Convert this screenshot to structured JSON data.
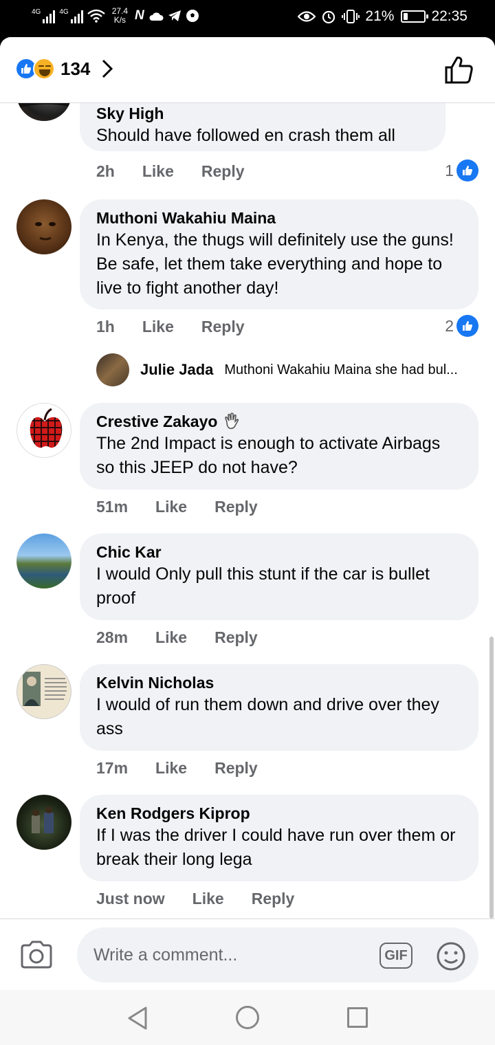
{
  "status_bar": {
    "net1": "4G",
    "net2": "4G",
    "speed_value": "27.4",
    "speed_unit": "K/s",
    "battery_percent": "21%",
    "battery_level": 0.21,
    "time": "22:35"
  },
  "header": {
    "reaction_count": "134",
    "reactions": [
      "like-icon",
      "haha-icon"
    ]
  },
  "comments": [
    {
      "name": "Sky High",
      "text": "Should have followed  en crash them all",
      "time": "2h",
      "like_label": "Like",
      "reply_label": "Reply",
      "like_count": "1"
    },
    {
      "name": "Muthoni Wakahiu Maina",
      "text": "In Kenya, the thugs will definitely use the guns!  Be safe, let them take everything and hope to live to fight another day!",
      "time": "1h",
      "like_label": "Like",
      "reply_label": "Reply",
      "like_count": "2",
      "reply_preview": {
        "name": "Julie Jada",
        "text": "Muthoni Wakahiu Maina she had bul..."
      }
    },
    {
      "name": "Crestive Zakayo",
      "text": "The 2nd Impact is enough to activate Airbags so this JEEP do not have?",
      "time": "51m",
      "like_label": "Like",
      "reply_label": "Reply"
    },
    {
      "name": "Chic Kar",
      "text": "I would Only pull this stunt if  the car is bullet proof",
      "time": "28m",
      "like_label": "Like",
      "reply_label": "Reply"
    },
    {
      "name": "Kelvin Nicholas",
      "text": "I would of run them down and drive over they ass",
      "time": "17m",
      "like_label": "Like",
      "reply_label": "Reply"
    },
    {
      "name": "Ken Rodgers Kiprop",
      "text": "If I was the driver I could have run over them or break their long lega",
      "time": "Just now",
      "like_label": "Like",
      "reply_label": "Reply"
    }
  ],
  "composer": {
    "placeholder": "Write a comment...",
    "gif_label": "GIF"
  },
  "colors": {
    "accent": "#1877f2",
    "bubble": "#f0f2f5",
    "secondary_text": "#65676b"
  }
}
